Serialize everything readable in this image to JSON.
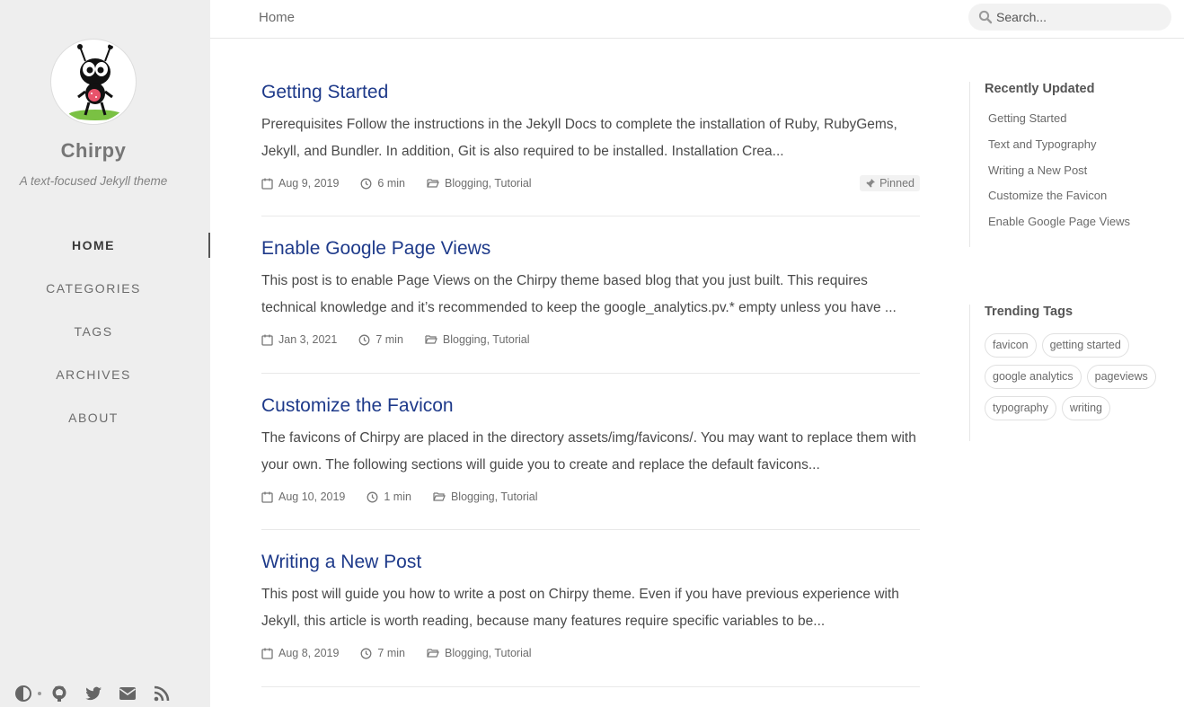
{
  "sidebar": {
    "site_title": "Chirpy",
    "site_subtitle": "A text-focused Jekyll theme",
    "nav": [
      {
        "label": "HOME",
        "active": true
      },
      {
        "label": "CATEGORIES"
      },
      {
        "label": "TAGS"
      },
      {
        "label": "ARCHIVES"
      },
      {
        "label": "ABOUT"
      }
    ],
    "bottom_icons": [
      "theme-toggle-icon",
      "github-icon",
      "twitter-icon",
      "email-icon",
      "rss-icon"
    ]
  },
  "topbar": {
    "breadcrumb": "Home",
    "search_placeholder": "Search..."
  },
  "posts": [
    {
      "title": "Getting Started",
      "excerpt": "Prerequisites Follow the instructions in the Jekyll Docs to complete the installation of Ruby, RubyGems, Jekyll, and Bundler. In addition, Git is also required to be installed. Installation Crea...",
      "date": "Aug 9, 2019",
      "read_time": "6 min",
      "categories": "Blogging, Tutorial",
      "pinned": "Pinned"
    },
    {
      "title": "Enable Google Page Views",
      "excerpt": "This post is to enable Page Views on the Chirpy theme based blog that you just built. This requires technical knowledge and it’s recommended to keep the google_analytics.pv.* empty unless you have ...",
      "date": "Jan 3, 2021",
      "read_time": "7 min",
      "categories": "Blogging, Tutorial"
    },
    {
      "title": "Customize the Favicon",
      "excerpt": "The favicons of Chirpy are placed in the directory assets/img/favicons/. You may want to replace them with your own. The following sections will guide you to create and replace the default favicons...",
      "date": "Aug 10, 2019",
      "read_time": "1 min",
      "categories": "Blogging, Tutorial"
    },
    {
      "title": "Writing a New Post",
      "excerpt": "This post will guide you how to write a post on Chirpy theme. Even if you have previous experience with Jekyll, this article is worth reading, because many features require specific variables to be...",
      "date": "Aug 8, 2019",
      "read_time": "7 min",
      "categories": "Blogging, Tutorial"
    }
  ],
  "recently_updated": {
    "title": "Recently Updated",
    "items": [
      "Getting Started",
      "Text and Typography",
      "Writing a New Post",
      "Customize the Favicon",
      "Enable Google Page Views"
    ]
  },
  "trending_tags": {
    "title": "Trending Tags",
    "tags": [
      "favicon",
      "getting started",
      "google analytics",
      "pageviews",
      "typography",
      "writing"
    ]
  },
  "colors": {
    "sidebar_bg": "#eeeeee",
    "post_title": "#1e3a8a",
    "text": "#4a4a4a"
  }
}
